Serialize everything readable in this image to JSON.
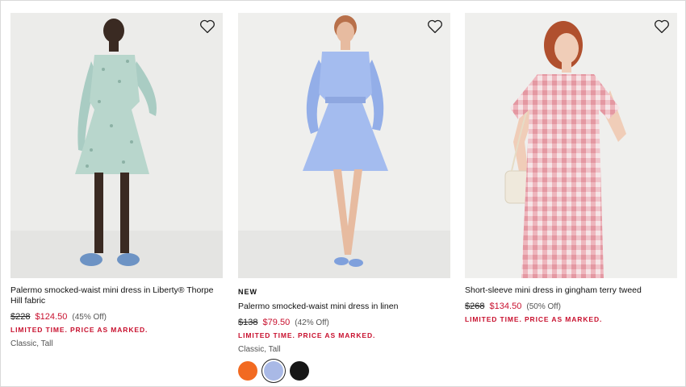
{
  "products": [
    {
      "flag": "",
      "title": "Palermo smocked-waist mini dress in Liberty® Thorpe Hill fabric",
      "was_price": "$228",
      "sale_price": "$124.50",
      "discount": "(45% Off)",
      "promo": "LIMITED TIME. PRICE AS MARKED.",
      "sizes": "Classic, Tall",
      "image_icon": "dress-photo-green-floral"
    },
    {
      "flag": "NEW",
      "title": "Palermo smocked-waist mini dress in linen",
      "was_price": "$138",
      "sale_price": "$79.50",
      "discount": "(42% Off)",
      "promo": "LIMITED TIME. PRICE AS MARKED.",
      "sizes": "Classic, Tall",
      "image_icon": "dress-photo-blue-linen",
      "swatches": [
        {
          "color": "#f26a21",
          "name": "orange"
        },
        {
          "color": "#a9b9e6",
          "name": "blue",
          "selected": true
        },
        {
          "color": "#161616",
          "name": "black"
        }
      ]
    },
    {
      "flag": "",
      "title": "Short-sleeve mini dress in gingham terry tweed",
      "was_price": "$268",
      "sale_price": "$134.50",
      "discount": "(50% Off)",
      "promo": "LIMITED TIME. PRICE AS MARKED.",
      "sizes": "",
      "image_icon": "dress-photo-pink-gingham"
    }
  ],
  "icons": {
    "wishlist": "heart-outline-icon"
  },
  "colors": {
    "sale": "#c8102e",
    "text": "#111111",
    "muted": "#555555"
  }
}
